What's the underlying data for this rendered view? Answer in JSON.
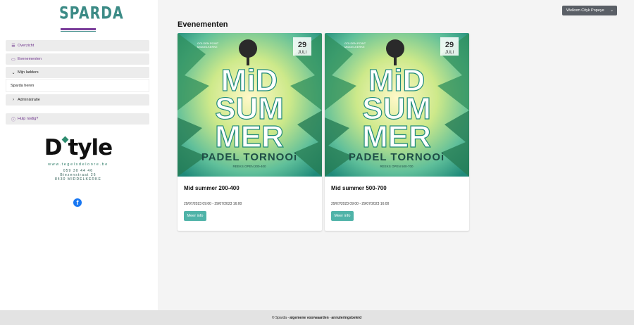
{
  "brand": {
    "logo_text": "SPARDA"
  },
  "sidebar": {
    "items": [
      {
        "icon": "list-icon",
        "label": "Overzicht"
      },
      {
        "icon": "calendar-icon",
        "label": "Evenementen"
      },
      {
        "icon": "chevron-down-icon",
        "label": "Mijn ladders"
      },
      {
        "icon": "chevron-right-icon",
        "label": "Administratie"
      },
      {
        "icon": "question-circle-icon",
        "label": "Hulp nodig?"
      }
    ],
    "ladders_sub": "Sparda heren"
  },
  "sponsor": {
    "logo_text_left": "D",
    "logo_text_right": "tyle",
    "website": "www.tegelsdeloore.be",
    "phone": "059 30 44 46",
    "street": "Biezenstraat 26",
    "city": "8430 MIDDELKERKE"
  },
  "header": {
    "welcome_label": "Welkom Cityk Popeye"
  },
  "main": {
    "title": "Evenementen",
    "events": [
      {
        "poster": {
          "top_left_1": "GOLDEN POINT",
          "top_left_2": "MIDDELKERKE",
          "day": "29",
          "month": "JULI",
          "line1": "MiD",
          "line2": "SUM",
          "line3": "MER",
          "subtitle": "PADEL TORNOOi",
          "series": "REEKS OPEN 200-400"
        },
        "title": "Mid summer 200-400",
        "date": "29/07/2023 09:00 - 29/07/2023 16:00",
        "button_label": "Meer info"
      },
      {
        "poster": {
          "top_left_1": "GOLDEN POINT",
          "top_left_2": "MIDDELKERKE",
          "day": "29",
          "month": "JULI",
          "line1": "MiD",
          "line2": "SUM",
          "line3": "MER",
          "subtitle": "PADEL TORNOOi",
          "series": "REEKS OPEN 500-700"
        },
        "title": "Mid summer 500-700",
        "date": "29/07/2023 09:00 - 29/07/2023 16:00",
        "button_label": "Meer info"
      }
    ]
  },
  "footer": {
    "prefix": "© Sparda - ",
    "terms": "algemene voorwaarden",
    "sep": " - ",
    "cancel": "annuleringsbeleid"
  },
  "colors": {
    "accent": "#6b2f8a",
    "teal": "#4fb3a8",
    "welcome_bg": "#5a5f66"
  }
}
